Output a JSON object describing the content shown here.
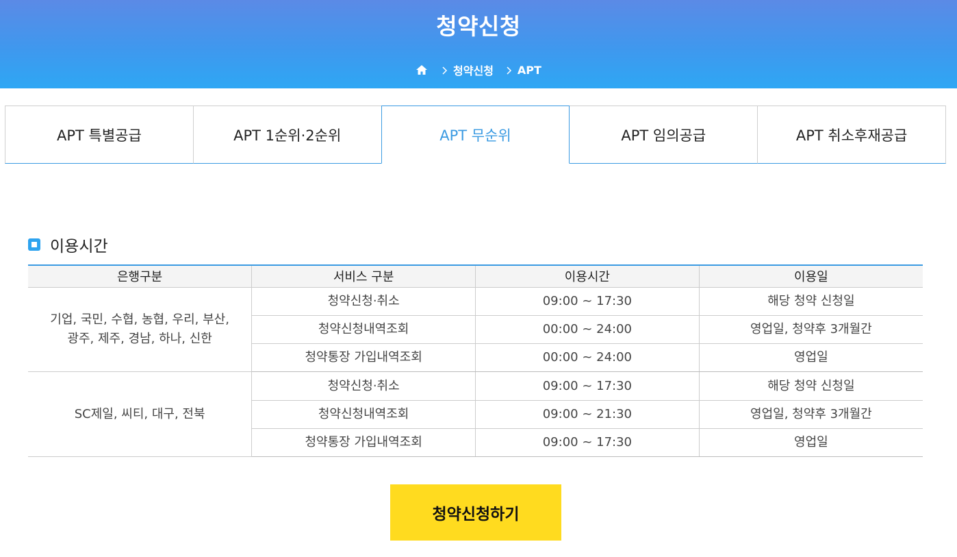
{
  "header": {
    "title": "청약신청",
    "breadcrumb": [
      "청약신청",
      "APT"
    ]
  },
  "tabs": [
    {
      "label": "APT 특별공급",
      "active": false
    },
    {
      "label": "APT 1순위·2순위",
      "active": false
    },
    {
      "label": "APT 무순위",
      "active": true
    },
    {
      "label": "APT 임의공급",
      "active": false
    },
    {
      "label": "APT 취소후재공급",
      "active": false
    }
  ],
  "section": {
    "title": "이용시간"
  },
  "table": {
    "headers": [
      "은행구분",
      "서비스 구분",
      "이용시간",
      "이용일"
    ],
    "groups": [
      {
        "banks_line1": "기업, 국민, 수협, 농협, 우리, 부산,",
        "banks_line2": "광주, 제주, 경남, 하나, 신한",
        "rows": [
          {
            "service": "청약신청·취소",
            "time": "09:00 ~ 17:30",
            "days": "해당 청약 신청일"
          },
          {
            "service": "청약신청내역조회",
            "time": "00:00 ~ 24:00",
            "days": "영업일, 청약후 3개월간"
          },
          {
            "service": "청약통장 가입내역조회",
            "time": "00:00 ~ 24:00",
            "days": "영업일"
          }
        ]
      },
      {
        "banks_line1": "SC제일, 씨티, 대구, 전북",
        "banks_line2": "",
        "rows": [
          {
            "service": "청약신청·취소",
            "time": "09:00 ~ 17:30",
            "days": "해당 청약 신청일"
          },
          {
            "service": "청약신청내역조회",
            "time": "09:00 ~ 21:30",
            "days": "영업일, 청약후 3개월간"
          },
          {
            "service": "청약통장 가입내역조회",
            "time": "09:00 ~ 17:30",
            "days": "영업일"
          }
        ]
      }
    ]
  },
  "apply_button": {
    "label": "청약신청하기"
  },
  "colors": {
    "header_gradient_top": "#5b8ae6",
    "header_gradient_bottom": "#2ea7f4",
    "accent": "#3a9ae2",
    "button_yellow": "#ffdb1f"
  },
  "icons": {
    "home": "home-icon",
    "breadcrumb_separator": "chevron-right-icon",
    "section_bullet": "square-bullet-icon"
  }
}
